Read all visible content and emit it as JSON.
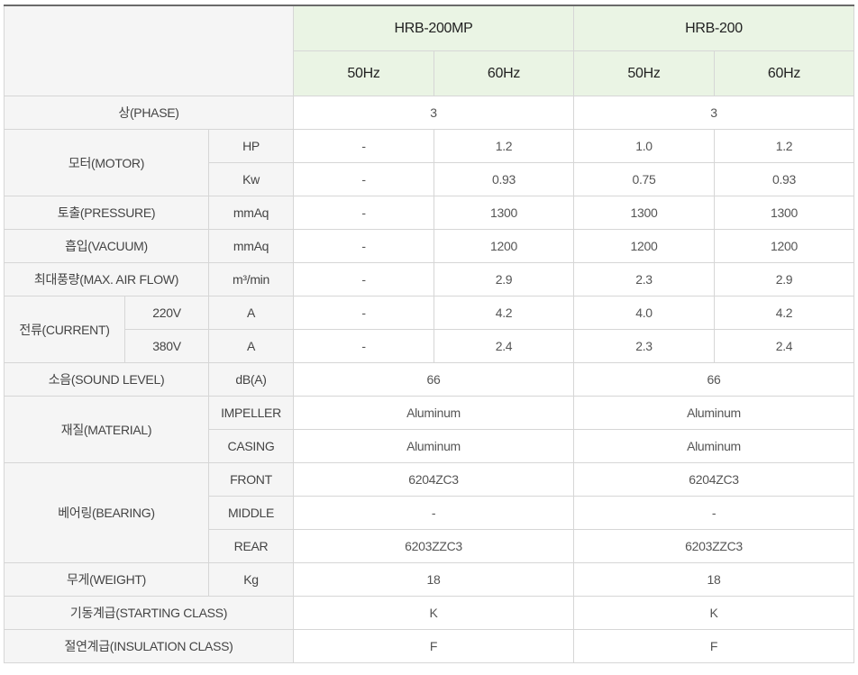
{
  "columns": {
    "models": [
      "HRB-200MP",
      "HRB-200"
    ],
    "freqs": [
      "50Hz",
      "60Hz",
      "50Hz",
      "60Hz"
    ]
  },
  "rows": {
    "phase": {
      "label": "상(PHASE)",
      "v": [
        "3",
        "3"
      ]
    },
    "motor": {
      "label": "모터(MOTOR)",
      "hp": {
        "unit": "HP",
        "v": [
          "-",
          "1.2",
          "1.0",
          "1.2"
        ]
      },
      "kw": {
        "unit": "Kw",
        "v": [
          "-",
          "0.93",
          "0.75",
          "0.93"
        ]
      }
    },
    "pressure": {
      "label": "토출(PRESSURE)",
      "unit": "mmAq",
      "v": [
        "-",
        "1300",
        "1300",
        "1300"
      ]
    },
    "vacuum": {
      "label": "흡입(VACUUM)",
      "unit": "mmAq",
      "v": [
        "-",
        "1200",
        "1200",
        "1200"
      ]
    },
    "airflow": {
      "label": "최대풍량(MAX. AIR FLOW)",
      "unit": "m³/min",
      "v": [
        "-",
        "2.9",
        "2.3",
        "2.9"
      ]
    },
    "current": {
      "label": "전류(CURRENT)",
      "v220": {
        "volt": "220V",
        "unit": "A",
        "v": [
          "-",
          "4.2",
          "4.0",
          "4.2"
        ]
      },
      "v380": {
        "volt": "380V",
        "unit": "A",
        "v": [
          "-",
          "2.4",
          "2.3",
          "2.4"
        ]
      }
    },
    "sound": {
      "label": "소음(SOUND LEVEL)",
      "unit": "dB(A)",
      "v": [
        "66",
        "66"
      ]
    },
    "material": {
      "label": "재질(MATERIAL)",
      "impeller": {
        "unit": "IMPELLER",
        "v": [
          "Aluminum",
          "Aluminum"
        ]
      },
      "casing": {
        "unit": "CASING",
        "v": [
          "Aluminum",
          "Aluminum"
        ]
      }
    },
    "bearing": {
      "label": "베어링(BEARING)",
      "front": {
        "unit": "FRONT",
        "v": [
          "6204ZC3",
          "6204ZC3"
        ]
      },
      "middle": {
        "unit": "MIDDLE",
        "v": [
          "-",
          "-"
        ]
      },
      "rear": {
        "unit": "REAR",
        "v": [
          "6203ZZC3",
          "6203ZZC3"
        ]
      }
    },
    "weight": {
      "label": "무게(WEIGHT)",
      "unit": "Kg",
      "v": [
        "18",
        "18"
      ]
    },
    "starting": {
      "label": "기동계급(STARTING CLASS)",
      "v": [
        "K",
        "K"
      ]
    },
    "insulation": {
      "label": "절연계급(INSULATION CLASS)",
      "v": [
        "F",
        "F"
      ]
    }
  }
}
